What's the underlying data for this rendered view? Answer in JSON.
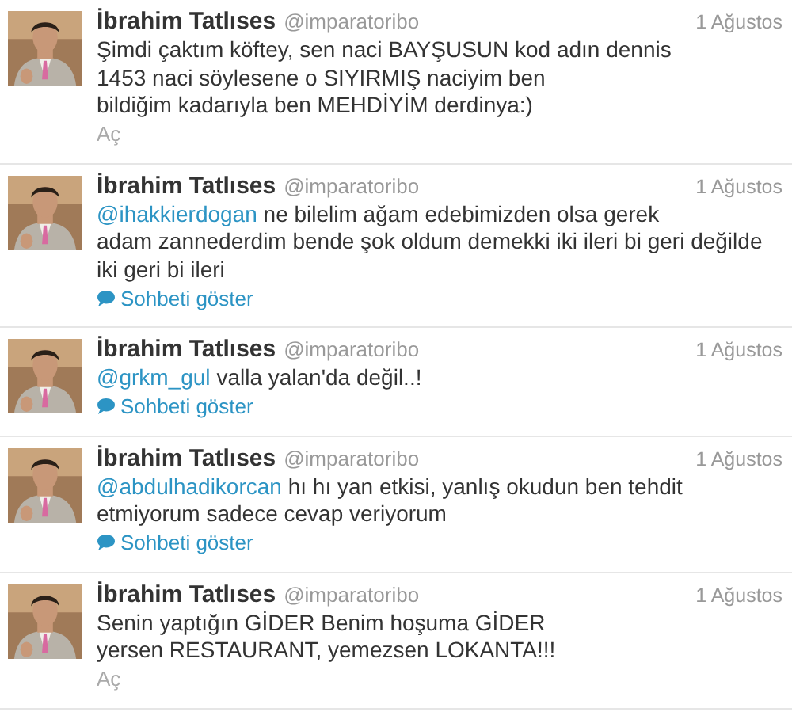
{
  "tweets": [
    {
      "author": "İbrahim Tatlıses",
      "handle": "@imparatoribo",
      "date": "1 Ağustos",
      "lines": [
        "Şimdi çaktım köftey, sen naci BAYŞUSUN kod adın dennis",
        "1453 naci söylesene o SIYIRMIŞ naciyim ben",
        "bildiğim kadarıyla ben MEHDİYİM derdinya:)"
      ],
      "action": {
        "kind": "expand",
        "label": "Aç"
      }
    },
    {
      "author": "İbrahim Tatlıses",
      "handle": "@imparatoribo",
      "date": "1 Ağustos",
      "mention": "@ihakkierdogan",
      "lines": [
        "ne bilelim ağam edebimizden olsa gerek",
        "adam zannederdim bende şok oldum demekki iki ileri bi geri değilde",
        "iki geri bi ileri"
      ],
      "action": {
        "kind": "conversation",
        "label": "Sohbeti göster"
      }
    },
    {
      "author": "İbrahim Tatlıses",
      "handle": "@imparatoribo",
      "date": "1 Ağustos",
      "mention": "@grkm_gul",
      "lines": [
        "valla yalan'da değil..!"
      ],
      "action": {
        "kind": "conversation",
        "label": "Sohbeti göster"
      }
    },
    {
      "author": "İbrahim Tatlıses",
      "handle": "@imparatoribo",
      "date": "1 Ağustos",
      "mention": "@abdulhadikorcan",
      "lines": [
        "hı hı yan etkisi, yanlış okudun ben tehdit",
        "etmiyorum sadece cevap veriyorum"
      ],
      "action": {
        "kind": "conversation",
        "label": "Sohbeti göster"
      }
    },
    {
      "author": "İbrahim Tatlıses",
      "handle": "@imparatoribo",
      "date": "1 Ağustos",
      "lines": [
        "Senin yaptığın GİDER Benim hoşuma GİDER",
        "yersen RESTAURANT, yemezsen LOKANTA!!!"
      ],
      "action": {
        "kind": "expand",
        "label": "Aç"
      }
    }
  ]
}
